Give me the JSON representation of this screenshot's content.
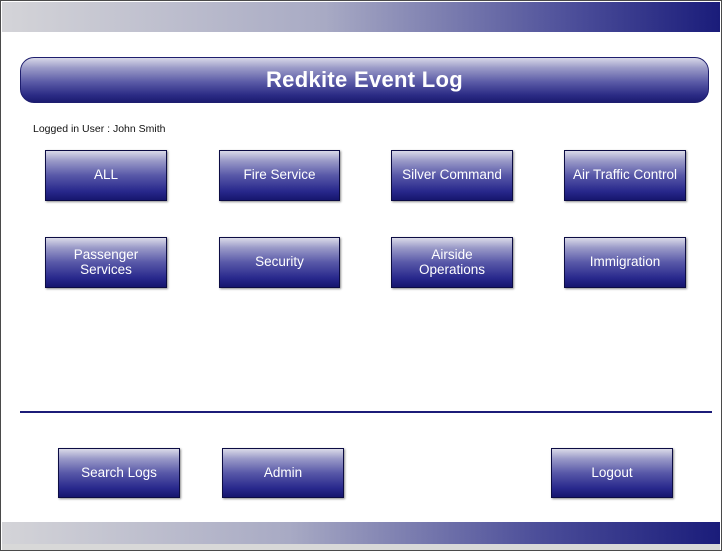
{
  "header": {
    "title": "Redkite Event Log"
  },
  "user": {
    "logged_in_text": "Logged in User : John Smith"
  },
  "categories": {
    "all": "ALL",
    "fire_service": "Fire Service",
    "silver_command": "Silver Command",
    "air_traffic_control": "Air Traffic Control",
    "passenger_services": "Passenger\nServices",
    "security": "Security",
    "airside_operations": "Airside\nOperations",
    "immigration": "Immigration"
  },
  "footer": {
    "search_logs": "Search Logs",
    "admin": "Admin",
    "logout": "Logout"
  },
  "colors": {
    "accent_dark": "#1c1c70",
    "accent_light": "#9c9cc8",
    "text_on_accent": "#ffffff"
  }
}
